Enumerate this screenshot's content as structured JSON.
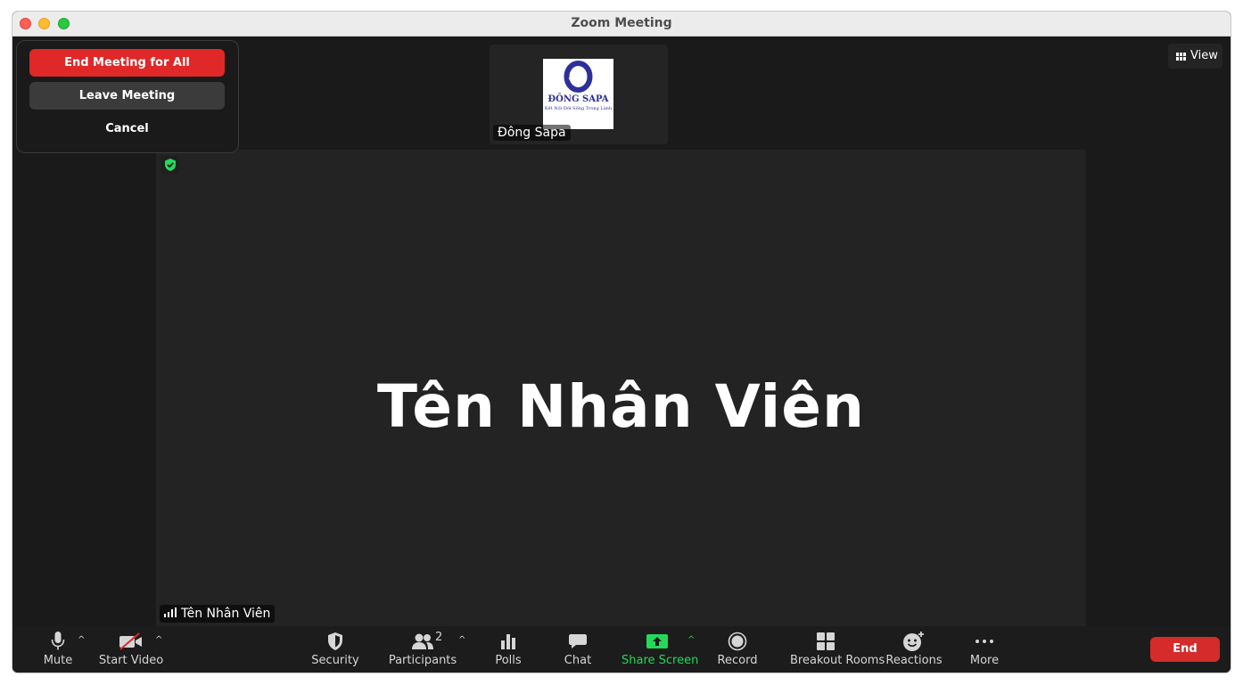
{
  "window": {
    "title": "Zoom Meeting"
  },
  "thumbnail": {
    "participant_name": "Đông Sapa",
    "logo_name": "ĐÔNG SAPA",
    "logo_tagline": "Kết Nối Đời Sống Trong Lành"
  },
  "view_button": {
    "label": "View"
  },
  "main_video": {
    "display_name": "Tên Nhân Viên",
    "name_tag": "Tên Nhân Viên"
  },
  "end_popup": {
    "end_for_all": "End Meeting for All",
    "leave": "Leave Meeting",
    "cancel": "Cancel"
  },
  "toolbar": {
    "mute": "Mute",
    "start_video": "Start Video",
    "security": "Security",
    "participants": "Participants",
    "participants_count": "2",
    "polls": "Polls",
    "chat": "Chat",
    "share_screen": "Share Screen",
    "record": "Record",
    "breakout_rooms": "Breakout Rooms",
    "reactions": "Reactions",
    "more": "More",
    "end": "End"
  },
  "colors": {
    "end_red": "#e02828",
    "share_green": "#23d959",
    "background": "#1a1a1a"
  }
}
